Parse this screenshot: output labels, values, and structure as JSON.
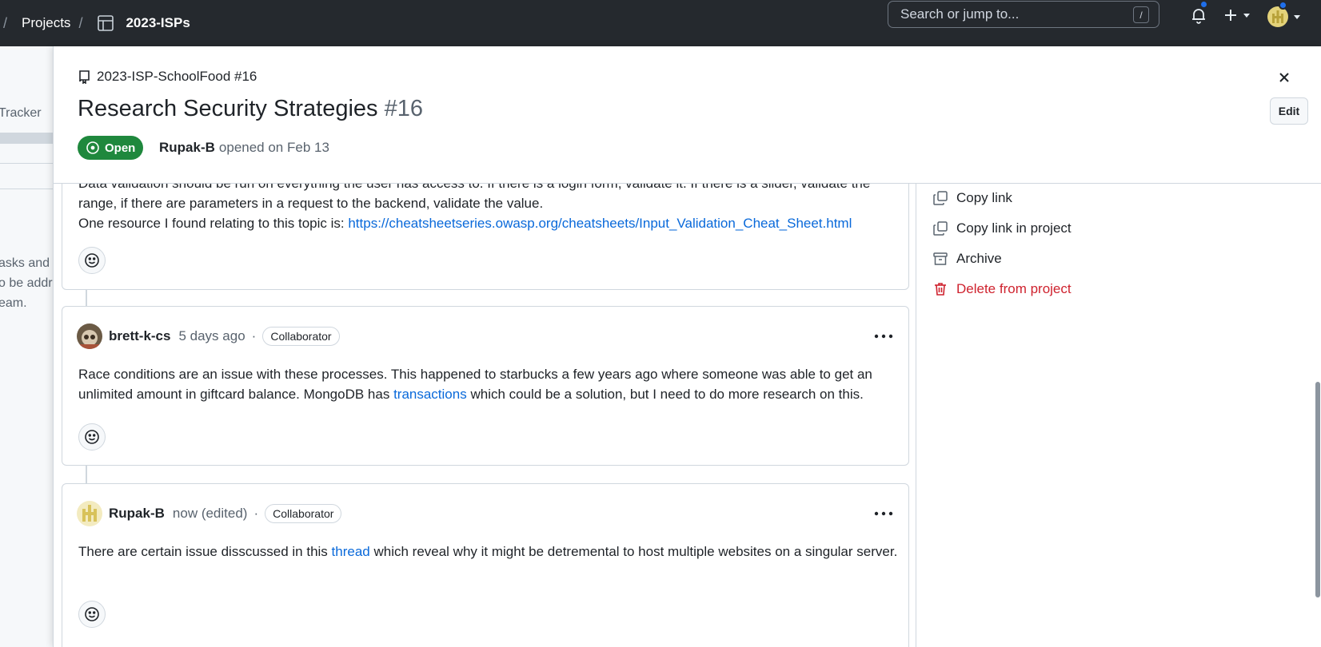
{
  "topbar": {
    "breadcrumb_sep": "/",
    "projects_label": "Projects",
    "project_name": "2023-ISPs",
    "search_placeholder": "Search or jump to...",
    "search_shortcut": "/"
  },
  "background_page": {
    "fragments": [
      "Tracker",
      "asks and",
      "o be addr",
      "eam."
    ]
  },
  "issue": {
    "repo_ref": "2023-ISP-SchoolFood #16",
    "title": "Research Security Strategies",
    "number": "#16",
    "state": "Open",
    "author": "Rupak-B",
    "opened_text": "opened on Feb 13",
    "edit_label": "Edit"
  },
  "first_comment": {
    "text_part1": "Data validation should be run on everything the user has access to. If there is a login form, validate it. If there is a slider, validate the range, if there are parameters in a request to the backend, validate the value.",
    "text_part2": "One resource I found relating to this topic is: ",
    "link": "https://cheatsheetseries.owasp.org/cheatsheets/Input_Validation_Cheat_Sheet.html"
  },
  "comments": [
    {
      "author": "brett-k-cs",
      "time": "5 days ago",
      "separator": "·",
      "badge": "Collaborator",
      "text_before": "Race conditions are an issue with these processes. This happened to starbucks a few years ago where someone was able to get an unlimited amount in giftcard balance. MongoDB has ",
      "link_text": "transactions",
      "text_after": " which could be a solution, but I need to do more research on this."
    },
    {
      "author": "Rupak-B",
      "time": "now (edited)",
      "separator": "·",
      "badge": "Collaborator",
      "text_before": "There are certain issue disscussed in this ",
      "link_text": "thread",
      "text_after": " which reveal why it might be detremental to host multiple websites on a singular server."
    }
  ],
  "sidebar": {
    "items": [
      {
        "label": "Copy link",
        "icon": "copy-icon"
      },
      {
        "label": "Copy link in project",
        "icon": "copy-icon"
      },
      {
        "label": "Archive",
        "icon": "archive-icon"
      },
      {
        "label": "Delete from project",
        "icon": "trash-icon"
      }
    ]
  },
  "colors": {
    "topbar_bg": "#25292e",
    "open_green": "#1f883d",
    "link_blue": "#0969da",
    "danger_red": "#cf222e",
    "notification_blue": "#1f6feb"
  }
}
